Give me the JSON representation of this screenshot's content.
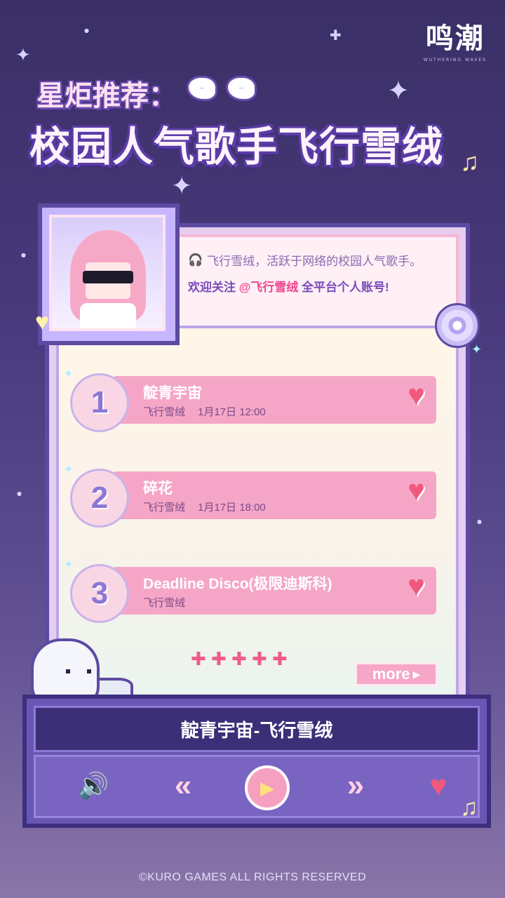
{
  "logo": {
    "main": "鸣潮",
    "sub": "WUTHERING WAVES"
  },
  "header": {
    "title_line1": "星炬推荐：",
    "title_line2": "校园人气歌手飞行雪绒",
    "decorations": [
      "wing-icon",
      "wing-icon",
      "music-note-icon"
    ]
  },
  "profile": {
    "headphones_icon": "headphones-icon",
    "description": "飞行雪绒，活跃于网络的校园人气歌手。",
    "follow_prefix": "欢迎关注",
    "follow_handle": "@飞行雪绒",
    "follow_suffix": "全平台个人账号!"
  },
  "songs": [
    {
      "rank": "1",
      "title": "靛青宇宙",
      "artist": "飞行雪绒",
      "date": "1月17日",
      "time": "12:00",
      "icon": "heart-icon"
    },
    {
      "rank": "2",
      "title": "碎花",
      "artist": "飞行雪绒",
      "date": "1月17日",
      "time": "18:00",
      "icon": "heart-icon"
    },
    {
      "rank": "3",
      "title": "Deadline Disco(极限迪斯科)",
      "artist": "飞行雪绒",
      "date": "",
      "time": "",
      "icon": "heart-icon"
    }
  ],
  "pagination_dots": "✚ ✚ ✚ ✚ ✚",
  "more_label": "more",
  "player": {
    "now_playing": "靛青宇宙-飞行雪绒",
    "icons": [
      "speaker-icon",
      "previous-icon",
      "play-icon",
      "next-icon",
      "heart-icon"
    ]
  },
  "footer": {
    "copyright": "©KURO GAMES ALL RIGHTS RESERVED"
  },
  "colors": {
    "background_top": "#3a2f66",
    "accent_pink": "#f5a6c6",
    "heart_red": "#f0587e",
    "purple_border": "#5d4aa2",
    "handle_pink": "#f0468e"
  }
}
